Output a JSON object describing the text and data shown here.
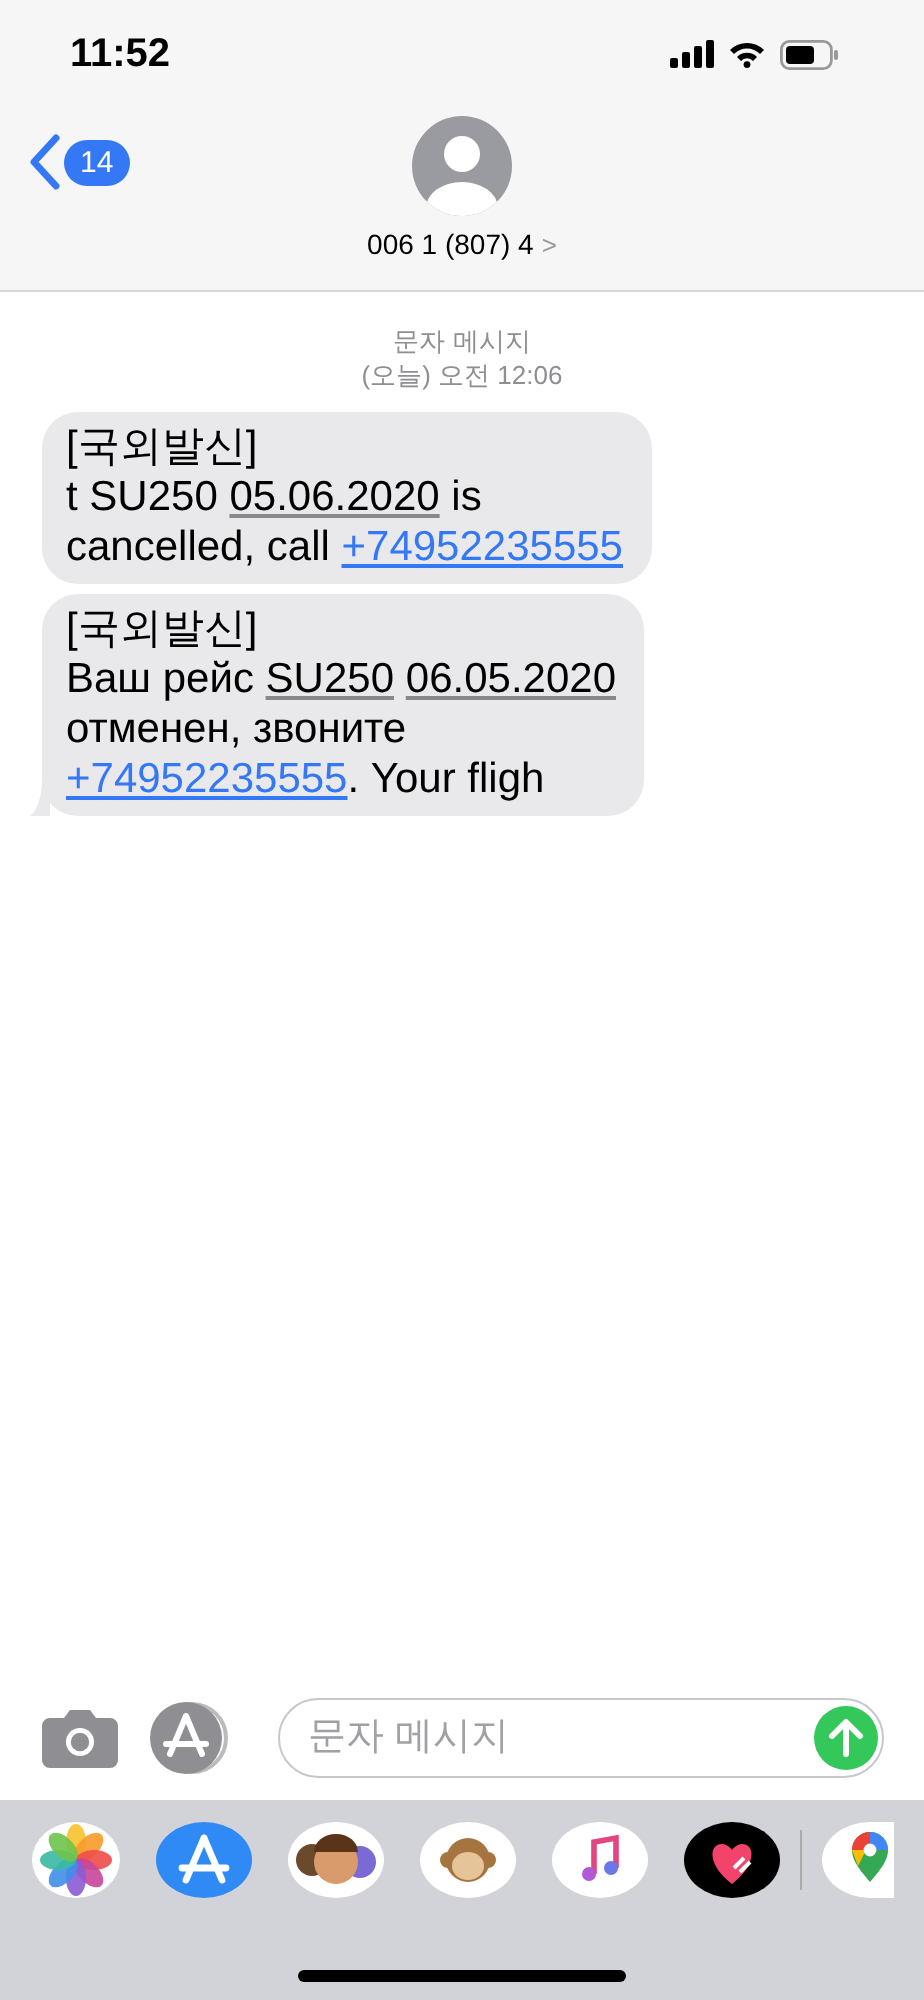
{
  "status_bar": {
    "time": "11:52"
  },
  "header": {
    "back_badge": "14",
    "contact": "006 1 (807) 4",
    "chevron": ">"
  },
  "timestamp": {
    "label": "문자 메시지",
    "time": "(오늘) 오전 12:06"
  },
  "messages": [
    {
      "lines": [
        [
          {
            "kind": "text",
            "text": "[국외발신]"
          }
        ],
        [
          {
            "kind": "text",
            "text": "t SU250 "
          },
          {
            "kind": "detected",
            "text": "05.06.2020"
          },
          {
            "kind": "text",
            "text": " is"
          }
        ],
        [
          {
            "kind": "text",
            "text": "cancelled, call "
          },
          {
            "kind": "link",
            "text": "+74952235555"
          }
        ]
      ],
      "tail": false
    },
    {
      "lines": [
        [
          {
            "kind": "text",
            "text": "[국외발신]"
          }
        ],
        [
          {
            "kind": "text",
            "text": "Ваш рейс "
          },
          {
            "kind": "detected",
            "text": "SU250"
          },
          {
            "kind": "detected",
            "text": "06.05.2020",
            "gap_before": true
          }
        ],
        [
          {
            "kind": "text",
            "text": "отменен, звоните"
          }
        ],
        [
          {
            "kind": "link",
            "text": "+74952235555"
          },
          {
            "kind": "text",
            "text": ". Your fligh"
          }
        ]
      ],
      "tail": true
    }
  ],
  "composer": {
    "placeholder": "문자 메시지"
  },
  "app_drawer": [
    {
      "kind": "photos"
    },
    {
      "kind": "appstore"
    },
    {
      "kind": "memoji"
    },
    {
      "kind": "animoji"
    },
    {
      "kind": "music"
    },
    {
      "kind": "heart"
    },
    {
      "kind": "maps"
    }
  ]
}
